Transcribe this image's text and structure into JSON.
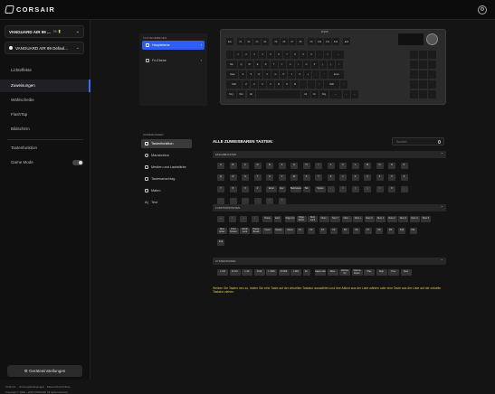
{
  "app": {
    "brand": "CORSAIR",
    "settings_icon": "gear-icon"
  },
  "sidebar": {
    "device_primary": {
      "name": "VANGUARD AIR 99 ...",
      "tag": "99 🔋"
    },
    "device_secondary": {
      "name": "VANGUARD AIR 99 Defaul..."
    },
    "items": [
      {
        "label": "Lichteffekte"
      },
      {
        "label": "Zuweisungen"
      },
      {
        "label": "Wählscheibe"
      },
      {
        "label": "FlashTap"
      },
      {
        "label": "Bildschirm"
      },
      {
        "label": "Tastenfunktion"
      },
      {
        "label": "Game Mode"
      }
    ],
    "device_settings_label": "Geräteeinstellungen",
    "footer_version": "iCUE 5.0.. · Nutzungsbedingungen · Datenschutzrichtlinie",
    "footer_copyright": "Copyright © 1994 – 2025 CORSAIR. All rights reserved."
  },
  "layers": {
    "title": "TASTENEBENEN",
    "items": [
      {
        "label": "Hauptebene"
      },
      {
        "label": "Fn-Ebene"
      }
    ]
  },
  "keyboard": {
    "model_label": "FN/UP",
    "rows": [
      [
        "Esc",
        "F1",
        "F2",
        "F3",
        "F4",
        "F5",
        "F6",
        "F7",
        "F8",
        "F9",
        "F10",
        "F11",
        "F12",
        "Entf"
      ],
      [
        "`",
        "1",
        "2",
        "3",
        "4",
        "5",
        "6",
        "7",
        "8",
        "9",
        "0",
        "-",
        "=",
        "←"
      ],
      [
        "Tab",
        "Q",
        "W",
        "E",
        "R",
        "T",
        "Y",
        "U",
        "I",
        "O",
        "P",
        "[",
        "]",
        "\\"
      ],
      [
        "Caps",
        "A",
        "S",
        "D",
        "F",
        "G",
        "H",
        "J",
        "K",
        "L",
        ";",
        "'",
        "Enter"
      ],
      [
        "Shift",
        "Z",
        "X",
        "C",
        "V",
        "B",
        "N",
        "M",
        ",",
        ".",
        "/",
        "Shift",
        "↑"
      ],
      [
        "Strg",
        "Win",
        "Alt",
        "",
        "Alt",
        "Fn",
        "Strg",
        "←",
        "↓",
        "→"
      ]
    ]
  },
  "categories": {
    "title": "ZUWEISUNGEN",
    "items": [
      {
        "label": "Tastenfunktion"
      },
      {
        "label": "Mausbutton"
      },
      {
        "label": "Medien und Lautstärke"
      },
      {
        "label": "Tastenanschlag"
      },
      {
        "label": "Makro"
      },
      {
        "label": "Text"
      }
    ]
  },
  "assignable": {
    "title": "ALLE ZUWEISBAREN TASTEN:",
    "search_placeholder": "Suchen",
    "sections": [
      {
        "title": "EINGABETASTEN",
        "rows": [
          [
            "A",
            "B",
            "C",
            "D",
            "E",
            "F",
            "G",
            "H",
            "I",
            "J",
            "K",
            "L",
            "M",
            "N",
            "O",
            "P"
          ],
          [
            "Q",
            "R",
            "S",
            "T",
            "U",
            "V",
            "W",
            "X",
            "Y",
            "Z",
            "1",
            "2",
            "3",
            "4",
            "5",
            "6"
          ],
          [
            "7",
            "8",
            "9",
            "0",
            "Enter",
            "Esc",
            "Backspace",
            "Tab",
            "Space",
            "-",
            "=",
            "[",
            "]",
            "\\",
            "#",
            ";"
          ],
          [
            "'",
            "`",
            ",",
            ".",
            "/",
            "<"
          ]
        ]
      },
      {
        "title": "FUNKTIONSTASTEN",
        "rows": [
          [
            "←",
            "↑",
            "→",
            "↓",
            "Home",
            "End",
            "Page Up",
            "Page Down",
            "Num Lock",
            "Num /",
            "Num *",
            "Num -",
            "Num +",
            "Num 0",
            "Num 1",
            "Num 2",
            "Num 3",
            "Num 4",
            "Num 5"
          ],
          [
            "Num Enter",
            "Print Screen",
            "Scroll Lock",
            "Pause Break",
            "Insert",
            "Delete",
            "Menu",
            "F1",
            "F2",
            "F3",
            "F4",
            "F5",
            "F6",
            "F7",
            "F8",
            "F9",
            "F10",
            "F11"
          ],
          [
            "F12"
          ]
        ]
      },
      {
        "title": "SYSTEMTASTEN",
        "rows": [
          [
            "L Ctrl",
            "R Ctrl",
            "L Alt",
            "R Alt",
            "L Shift",
            "R Shift",
            "L Win",
            "Fn",
            "Caps Lock",
            "Mute",
            "Volume Up",
            "Volume Down",
            "Play",
            "Stop",
            "Prev",
            "Next"
          ]
        ]
      }
    ],
    "hint": "Weisen Sie Tasten neu zu, indem Sie eine Taste auf der virtuellen Tastatur auswählen und ihre Aktion aus der Liste wählen oder eine Taste aus der Liste auf die virtuelle Tastatur ziehen."
  }
}
